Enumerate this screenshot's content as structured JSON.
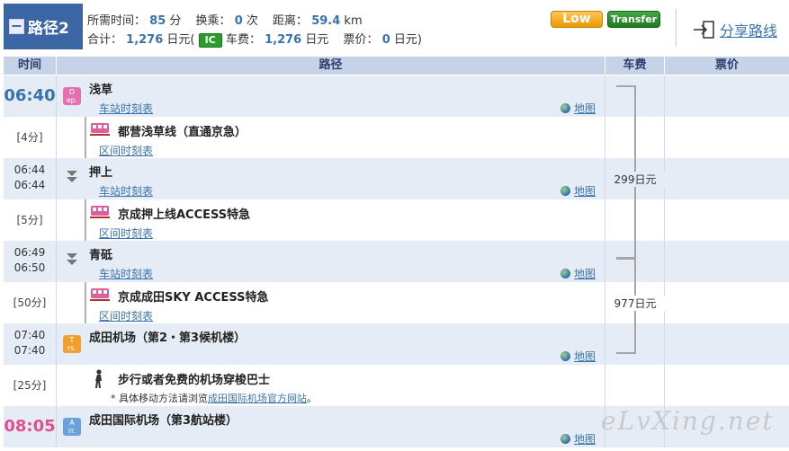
{
  "header": {
    "route_label": "路径2",
    "collapse_symbol": "−",
    "line1": {
      "time_label": "所需时间：",
      "time_value": "85",
      "time_unit": "分",
      "transfer_label": "换乘：",
      "transfer_value": "0",
      "transfer_unit": "次",
      "distance_label": "距离：",
      "distance_value": "59.4",
      "distance_unit": "km"
    },
    "line2": {
      "total_label": "合计：",
      "total_value": "1,276",
      "total_unit": "日元(",
      "ic_label": "IC",
      "fare_label": "车费：",
      "fare_value": "1,276",
      "fare_unit": "日元",
      "ticket_label": "票价：",
      "ticket_value": "0",
      "ticket_unit": "日元)"
    },
    "low_badge": "Low",
    "transfer_badge": "Transfer",
    "share_label": "分享路线"
  },
  "columns": {
    "time": "时间",
    "route": "路径",
    "fare": "车费",
    "price": "票价"
  },
  "rows": {
    "r0": {
      "time": "06:40",
      "badge_top": "D",
      "badge_bot": "ep.",
      "station": "浅草",
      "link": "车站时刻表",
      "map": "地图"
    },
    "r1": {
      "duration": "[4分]",
      "line": "都营浅草线（直通京急）",
      "link": "区间时刻表"
    },
    "r2": {
      "time_arr": "06:44",
      "time_dep": "06:44",
      "station": "押上",
      "link": "车站时刻表",
      "map": "地图"
    },
    "r3": {
      "duration": "[5分]",
      "line": "京成押上线ACCESS特急",
      "link": "区间时刻表"
    },
    "r4": {
      "time_arr": "06:49",
      "time_dep": "06:50",
      "station": "青砥",
      "link": "车站时刻表",
      "map": "地图"
    },
    "r5": {
      "duration": "[50分]",
      "line": "京成成田SKY ACCESS特急",
      "link": "区间时刻表"
    },
    "r6": {
      "time_arr": "07:40",
      "time_dep": "07:40",
      "badge_top": "T",
      "badge_bot": "rs.",
      "station": "成田机场（第2・第3候机楼）",
      "map": "地图"
    },
    "r7": {
      "duration": "[25分]",
      "line": "步行或者免费的机场穿梭巴士",
      "note_prefix": "* 具体移动方法请浏览",
      "note_link": "成田国际机场官方网站",
      "note_suffix": "。"
    },
    "r8": {
      "time": "08:05",
      "badge_top": "A",
      "badge_bot": "rr.",
      "station": "成田国际机场（第3航站楼）",
      "map": "地图"
    }
  },
  "fares": {
    "f1": "299日元",
    "f2": "977日元"
  },
  "watermark": "eLvXing.net"
}
